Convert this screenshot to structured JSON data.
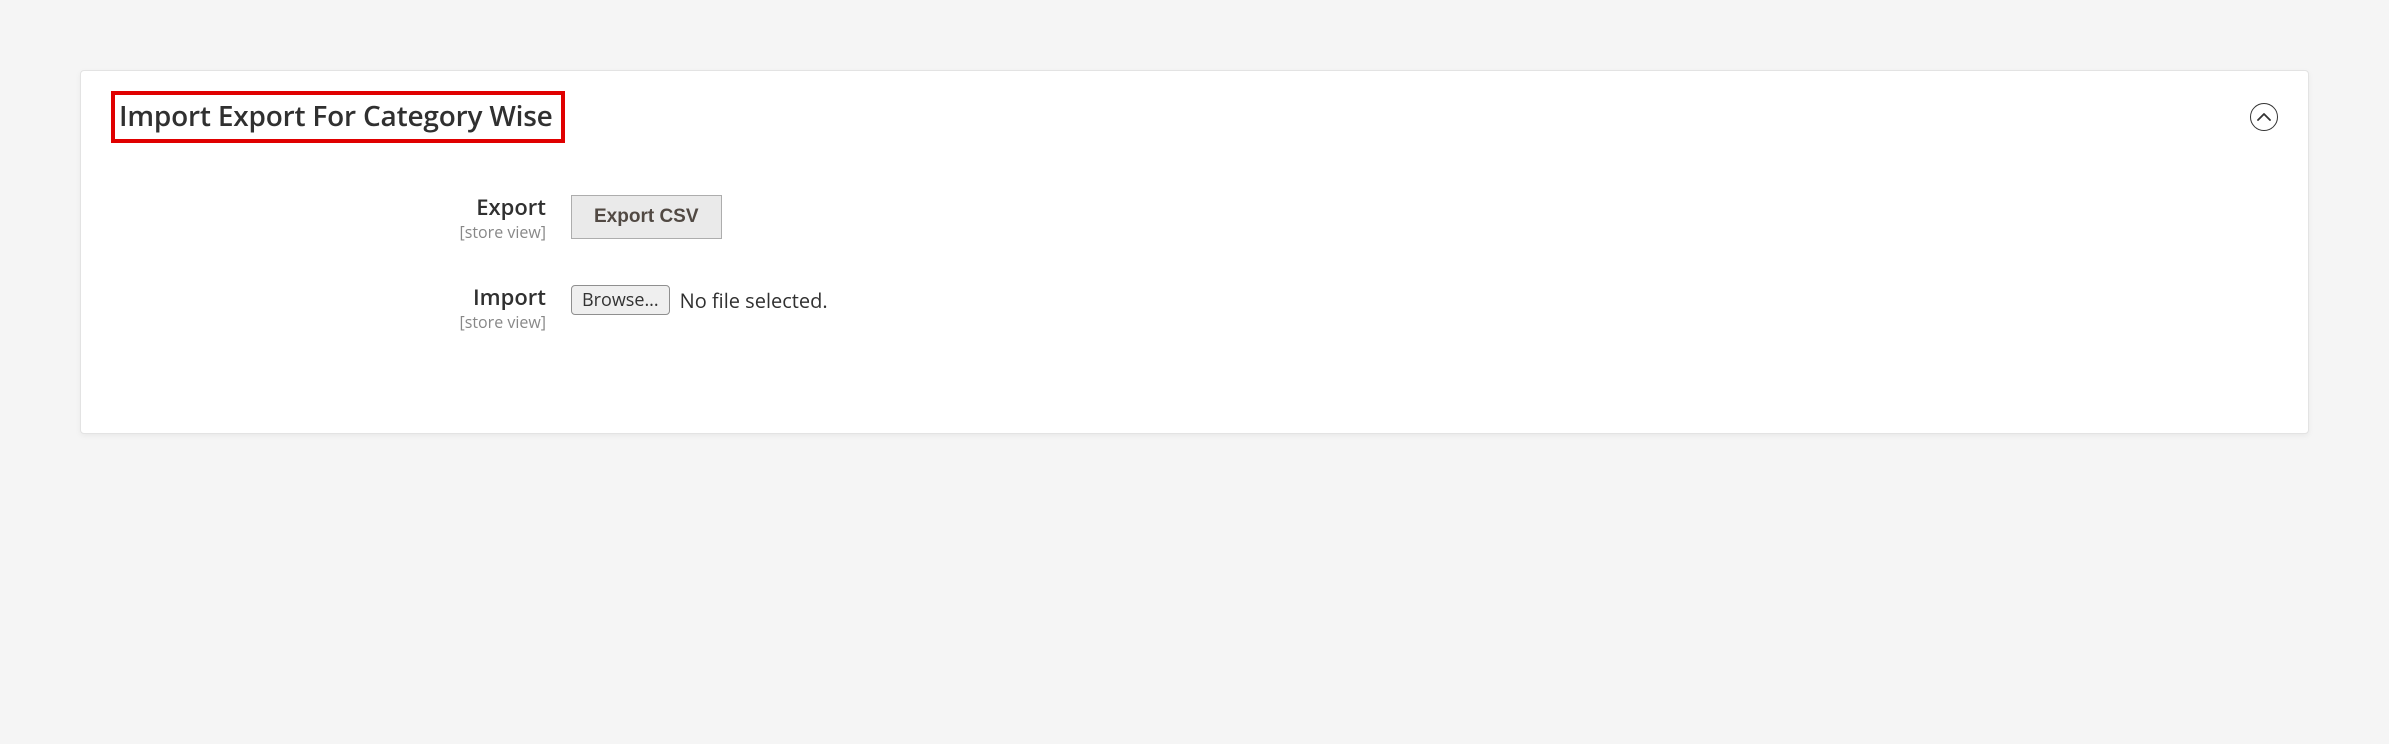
{
  "panel": {
    "title": "Import Export For Category Wise",
    "collapse_icon": "chevron-up"
  },
  "fields": {
    "export": {
      "label": "Export",
      "scope": "[store view]",
      "button_label": "Export CSV"
    },
    "import": {
      "label": "Import",
      "scope": "[store view]",
      "browse_label": "Browse...",
      "file_status": "No file selected."
    }
  }
}
